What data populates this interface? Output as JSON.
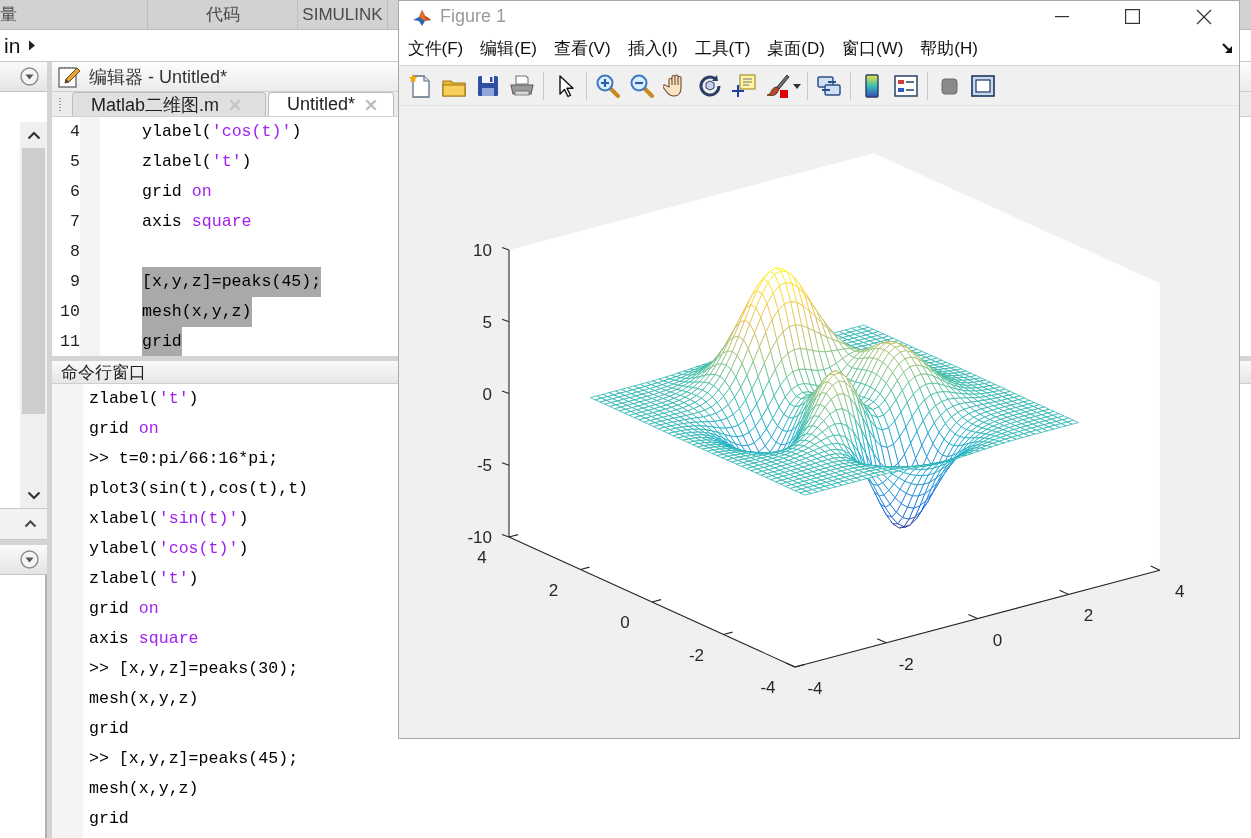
{
  "ribbon": {
    "tabs": [
      {
        "label": "量"
      },
      {
        "label": "代码"
      },
      {
        "label": "SIMULINK"
      }
    ]
  },
  "address_bar": {
    "path": "in"
  },
  "editor": {
    "title": "编辑器 - Untitled*",
    "tabs": [
      {
        "label": "Matlab二维图.m",
        "selected": false
      },
      {
        "label": "Untitled*",
        "selected": true
      }
    ],
    "lines": [
      {
        "number": "4",
        "selected": false,
        "tokens": [
          {
            "kind": "plain",
            "text": "ylabel("
          },
          {
            "kind": "string",
            "text": "'cos(t)'"
          },
          {
            "kind": "plain",
            "text": ")"
          }
        ]
      },
      {
        "number": "5",
        "selected": false,
        "tokens": [
          {
            "kind": "plain",
            "text": "zlabel("
          },
          {
            "kind": "string",
            "text": "'t'"
          },
          {
            "kind": "plain",
            "text": ")"
          }
        ]
      },
      {
        "number": "6",
        "selected": false,
        "tokens": [
          {
            "kind": "plain",
            "text": "grid "
          },
          {
            "kind": "string",
            "text": "on"
          }
        ]
      },
      {
        "number": "7",
        "selected": false,
        "tokens": [
          {
            "kind": "plain",
            "text": "axis "
          },
          {
            "kind": "string",
            "text": "square"
          }
        ]
      },
      {
        "number": "8",
        "selected": false
      },
      {
        "number": "9",
        "selected": true,
        "tokens": [
          {
            "kind": "plain",
            "text": "[x,y,z]=peaks(45);"
          }
        ]
      },
      {
        "number": "10",
        "selected": true,
        "tokens": [
          {
            "kind": "plain",
            "text": "mesh(x,y,z)"
          }
        ]
      },
      {
        "number": "11",
        "selected": true,
        "tokens": [
          {
            "kind": "plain",
            "text": "grid"
          }
        ]
      }
    ]
  },
  "command_window": {
    "title": "命令行窗口",
    "lines": [
      {
        "tokens": [
          {
            "kind": "plain",
            "text": "zlabel("
          },
          {
            "kind": "string",
            "text": "'t'"
          },
          {
            "kind": "plain",
            "text": ")"
          }
        ]
      },
      {
        "tokens": [
          {
            "kind": "plain",
            "text": "grid "
          },
          {
            "kind": "string",
            "text": "on"
          }
        ]
      },
      {
        "tokens": [
          {
            "kind": "plain",
            "text": ">> t=0:pi/66:16*pi;"
          }
        ]
      },
      {
        "tokens": [
          {
            "kind": "plain",
            "text": "plot3(sin(t),cos(t),t)"
          }
        ]
      },
      {
        "tokens": [
          {
            "kind": "plain",
            "text": "xlabel("
          },
          {
            "kind": "string",
            "text": "'sin(t)'"
          },
          {
            "kind": "plain",
            "text": ")"
          }
        ]
      },
      {
        "tokens": [
          {
            "kind": "plain",
            "text": "ylabel("
          },
          {
            "kind": "string",
            "text": "'cos(t)'"
          },
          {
            "kind": "plain",
            "text": ")"
          }
        ]
      },
      {
        "tokens": [
          {
            "kind": "plain",
            "text": "zlabel("
          },
          {
            "kind": "string",
            "text": "'t'"
          },
          {
            "kind": "plain",
            "text": ")"
          }
        ]
      },
      {
        "tokens": [
          {
            "kind": "plain",
            "text": "grid "
          },
          {
            "kind": "string",
            "text": "on"
          }
        ]
      },
      {
        "tokens": [
          {
            "kind": "plain",
            "text": "axis "
          },
          {
            "kind": "string",
            "text": "square"
          }
        ]
      },
      {
        "tokens": [
          {
            "kind": "plain",
            "text": ">> [x,y,z]=peaks(30);"
          }
        ]
      },
      {
        "tokens": [
          {
            "kind": "plain",
            "text": "mesh(x,y,z)"
          }
        ]
      },
      {
        "tokens": [
          {
            "kind": "plain",
            "text": "grid"
          }
        ]
      },
      {
        "tokens": [
          {
            "kind": "plain",
            "text": ">> [x,y,z]=peaks(45);"
          }
        ]
      },
      {
        "tokens": [
          {
            "kind": "plain",
            "text": "mesh(x,y,z)"
          }
        ]
      },
      {
        "tokens": [
          {
            "kind": "plain",
            "text": "grid"
          }
        ]
      }
    ]
  },
  "figure": {
    "title": "Figure 1",
    "active": false,
    "menu": [
      "文件(F)",
      "编辑(E)",
      "查看(V)",
      "插入(I)",
      "工具(T)",
      "桌面(D)",
      "窗口(W)",
      "帮助(H)"
    ],
    "plot": {
      "vertical_axis_ticks": [
        "10",
        "5",
        "0",
        "-5",
        "-10"
      ],
      "left_axis_ticks": [
        "4",
        "2",
        "0",
        "-2",
        "-4"
      ],
      "right_axis_ticks": [
        "-4",
        "-2",
        "0",
        "2",
        "4"
      ]
    }
  }
}
